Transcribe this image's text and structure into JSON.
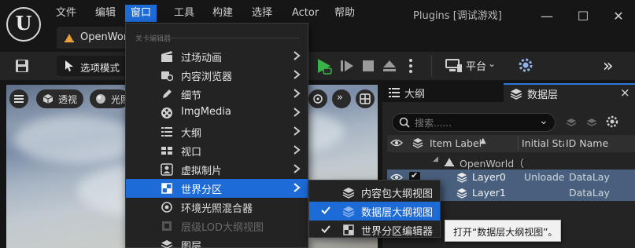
{
  "titlebar": {
    "logo_text": "U",
    "menus": [
      "文件",
      "编辑",
      "窗口",
      "工具",
      "构建",
      "选择",
      "Actor",
      "帮助"
    ],
    "active_menu": "窗口",
    "window_title": "Plugins [调试游戏]",
    "buttons": {
      "minimize": "—",
      "maximize": "☐",
      "close": "✕"
    }
  },
  "level_tab": {
    "label": "OpenWorld"
  },
  "toolbar": {
    "mode_label": "选项模式",
    "platform_label": "平台"
  },
  "viewport": {
    "view_label": "透视",
    "lit_label": "光照"
  },
  "outliner": {
    "tab_label": "大纲",
    "datalayer_tab_label": "数据层",
    "close": "×",
    "search_placeholder": "搜索......",
    "columns": {
      "item_label": "Item Label",
      "initial_state": "Initial Sta",
      "id_name": "ID Name"
    },
    "rows": [
      {
        "label": "OpenWorld（",
        "state": "",
        "id": ""
      },
      {
        "label": "Layer0",
        "state": "Unloade",
        "id": "DataLay"
      },
      {
        "label": "Layer1",
        "state": "",
        "id": "DataLay"
      }
    ]
  },
  "dropdown": {
    "section_label": "关卡编辑器",
    "items": [
      {
        "label": "过场动画",
        "icon": "film-icon",
        "arrow": true
      },
      {
        "label": "内容浏览器",
        "icon": "camera-icon",
        "arrow": true
      },
      {
        "label": "细节",
        "icon": "pencil-icon",
        "arrow": true
      },
      {
        "label": "ImgMedia",
        "icon": "film-reel-icon",
        "arrow": true
      },
      {
        "label": "大纲",
        "icon": "list-icon",
        "arrow": true
      },
      {
        "label": "视口",
        "icon": "grid-icon",
        "arrow": true
      },
      {
        "label": "虚拟制片",
        "icon": "portrait-icon",
        "arrow": true
      },
      {
        "label": "世界分区",
        "icon": "world-partition-icon",
        "arrow": true
      },
      {
        "label": "环境光照混合器",
        "icon": "bulb-icon",
        "arrow": false
      },
      {
        "label": "层级LOD大纲视图",
        "icon": "hlod-icon",
        "arrow": false
      },
      {
        "label": "图层",
        "icon": "layers-icon",
        "arrow": false
      }
    ]
  },
  "submenu": {
    "items": [
      {
        "label": "内容包大纲视图",
        "checked": false
      },
      {
        "label": "数据层大纲视图",
        "checked": true
      },
      {
        "label": "世界分区编辑器",
        "checked": true
      }
    ]
  },
  "tooltip": {
    "text": "打开“数据层大纲视图”。"
  },
  "colors": {
    "accent": "#1d6bd6",
    "selected_row": "#48607e",
    "play": "#39b54a"
  }
}
